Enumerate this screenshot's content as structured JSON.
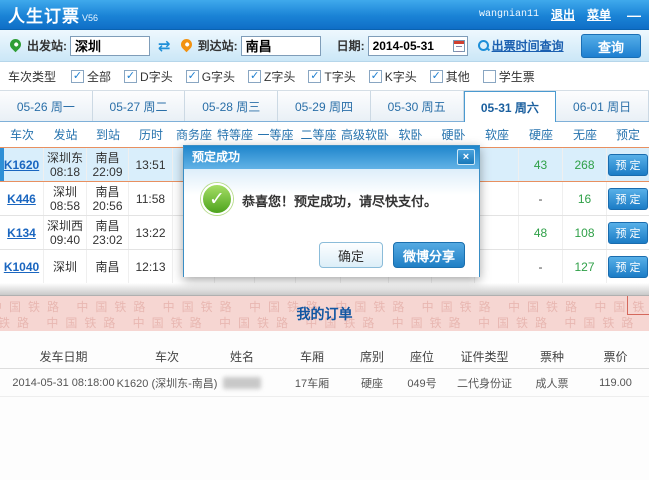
{
  "window": {
    "title": "人生订票",
    "version": "V56",
    "username": "wangnian11",
    "logout": "退出",
    "menu": "菜单",
    "minimize": "—"
  },
  "search": {
    "depart_label": "出发站:",
    "depart_value": "深圳",
    "arrive_label": "到达站:",
    "arrive_value": "南昌",
    "date_label": "日期:",
    "date_value": "2014-05-31",
    "time_query_link": "出票时间查询",
    "query_button": "查询"
  },
  "filters": {
    "label": "车次类型",
    "options": [
      {
        "label": "全部",
        "mark": "✓"
      },
      {
        "label": "D字头",
        "mark": "✓"
      },
      {
        "label": "G字头",
        "mark": "✓"
      },
      {
        "label": "Z字头",
        "mark": "✓"
      },
      {
        "label": "T字头",
        "mark": "✓"
      },
      {
        "label": "K字头",
        "mark": "✓"
      },
      {
        "label": "其他",
        "mark": "✓"
      },
      {
        "label": "学生票",
        "mark": ""
      }
    ]
  },
  "date_tabs": [
    {
      "label": "05-26 周一"
    },
    {
      "label": "05-27 周二"
    },
    {
      "label": "05-28 周三"
    },
    {
      "label": "05-29 周四"
    },
    {
      "label": "05-30 周五"
    },
    {
      "label": "05-31 周六"
    },
    {
      "label": "06-01 周日"
    }
  ],
  "train_table": {
    "headers": [
      "车次",
      "发站",
      "到站",
      "历时",
      "商务座",
      "特等座",
      "一等座",
      "二等座",
      "高级软卧",
      "软卧",
      "硬卧",
      "软座",
      "硬座",
      "无座",
      "预定"
    ],
    "book_label": "预 定",
    "rows": [
      {
        "train": "K1620",
        "from_station": "深圳东",
        "from_time": "08:18",
        "to_station": "南昌",
        "to_time": "22:09",
        "duration": "13:51",
        "hard_seat": "43",
        "no_seat": "268"
      },
      {
        "train": "K446",
        "from_station": "深圳",
        "from_time": "08:58",
        "to_station": "南昌",
        "to_time": "20:56",
        "duration": "11:58",
        "hard_seat": "-",
        "no_seat": "16"
      },
      {
        "train": "K134",
        "from_station": "深圳西",
        "from_time": "09:40",
        "to_station": "南昌",
        "to_time": "23:02",
        "duration": "13:22",
        "hard_seat": "48",
        "no_seat": "108"
      },
      {
        "train": "K1040",
        "from_station": "深圳",
        "from_time": "",
        "to_station": "南昌",
        "to_time": "",
        "duration": "12:13",
        "hard_seat": "-",
        "no_seat": "127"
      }
    ]
  },
  "dialog": {
    "title": "预定成功",
    "close": "×",
    "check_mark": "✓",
    "message": "恭喜您！预定成功，请尽快支付。",
    "ok_button": "确定",
    "share_button": "微博分享"
  },
  "orders": {
    "section_title": "我的订单",
    "watermark": "中国铁路 中国铁路 中国铁路 中国铁路 中国铁路 中国铁路 中国铁路 中国铁路 中国铁路 中国铁路",
    "headers": [
      "发车日期",
      "车次",
      "姓名",
      "车厢",
      "席别",
      "座位",
      "证件类型",
      "票种",
      "票价"
    ],
    "row": {
      "depart_datetime": "2014-05-31 08:18:00",
      "train": "K1620 (深圳东-南昌)",
      "carriage": "17车厢",
      "seat_class": "硬座",
      "seat_no": "049号",
      "id_type": "二代身份证",
      "ticket_type": "成人票",
      "price": "119.00"
    }
  },
  "colors": {
    "accent_blue": "#1d7fd0",
    "highlight_row": "#d9eefb",
    "highlight_border": "#e89060",
    "seat_count_green": "#2fa048",
    "pink_band": "#f6d6d2",
    "success_green": "#4da31d"
  }
}
